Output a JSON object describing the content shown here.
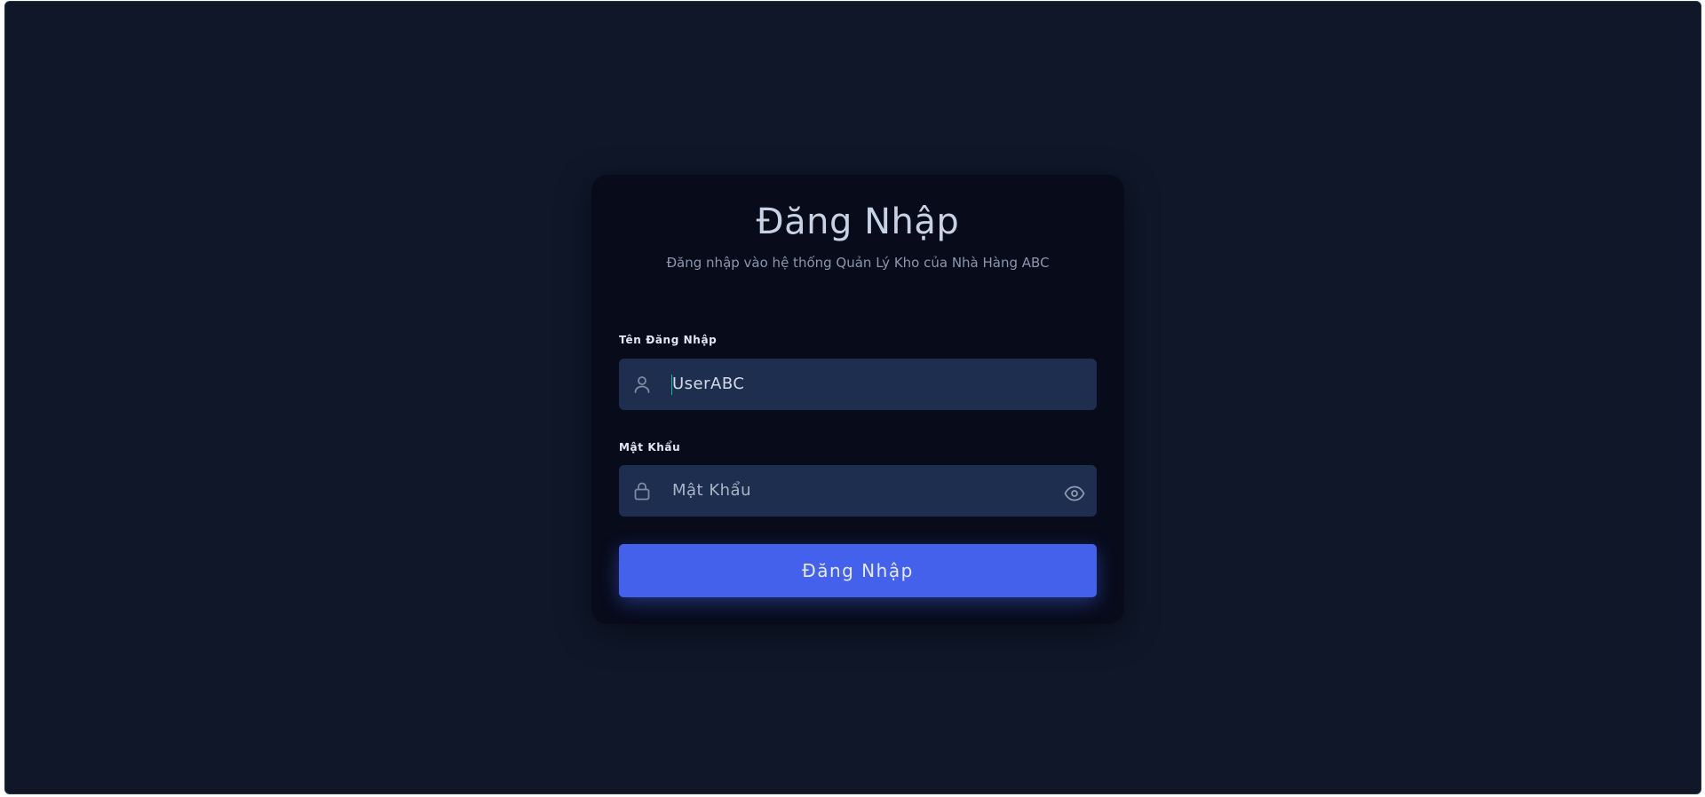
{
  "login": {
    "title": "Đăng Nhập",
    "subtitle": "Đăng nhập vào hệ thống Quản Lý Kho của Nhà Hàng ABC",
    "username": {
      "label": "Tên Đăng Nhập",
      "value": "UserABC",
      "icon": "user-icon"
    },
    "password": {
      "label": "Mật Khẩu",
      "placeholder": "Mật Khẩu",
      "icon": "lock-icon",
      "toggle_icon": "eye-icon"
    },
    "submit_label": "Đăng Nhập"
  },
  "colors": {
    "background": "#0f1729",
    "card": "#070b1a",
    "input": "#1d2e4f",
    "accent": "#4461ec",
    "caret": "#14b8a6"
  }
}
